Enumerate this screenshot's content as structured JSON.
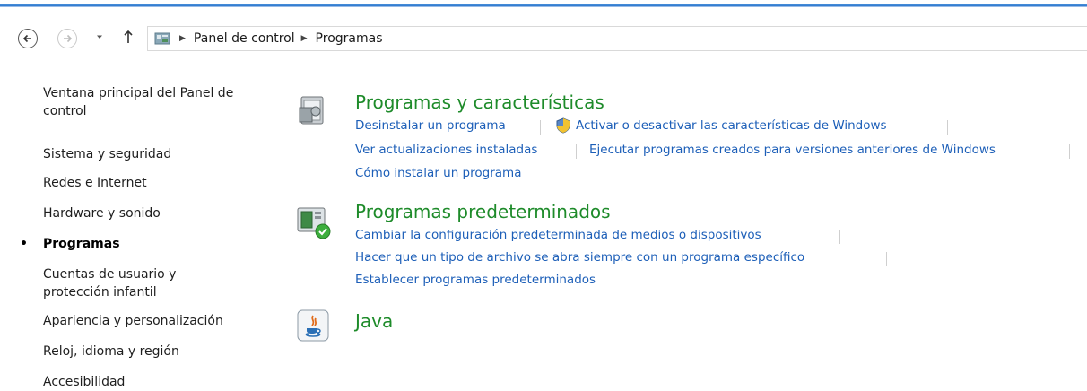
{
  "navigation": {
    "back_icon": "back-arrow-icon",
    "forward_icon": "forward-arrow-icon",
    "recent_icon": "chevron-down-icon",
    "up_icon": "up-arrow-icon",
    "breadcrumb": [
      "Panel de control",
      "Programas"
    ]
  },
  "sidebar": {
    "items": [
      {
        "label_line1": "Ventana principal del Panel de",
        "label_line2": "control"
      },
      {
        "label": "Sistema y seguridad"
      },
      {
        "label": "Redes e Internet"
      },
      {
        "label": "Hardware y sonido"
      },
      {
        "label": "Programas",
        "active": true
      },
      {
        "label_line1": "Cuentas de usuario y",
        "label_line2": "protección infantil"
      },
      {
        "label": "Apariencia y personalización"
      },
      {
        "label": "Reloj, idioma y región"
      },
      {
        "label": "Accesibilidad"
      }
    ]
  },
  "sections": [
    {
      "title": "Programas y características",
      "icon": "programs-features-icon",
      "links": [
        "Desinstalar un programa",
        "Activar o desactivar las características de Windows",
        "Ver actualizaciones instaladas",
        "Ejecutar programas creados para versiones anteriores de Windows",
        "Cómo instalar un programa"
      ]
    },
    {
      "title": "Programas predeterminados",
      "icon": "default-programs-icon",
      "links": [
        "Cambiar la configuración predeterminada de medios o dispositivos",
        "Hacer que un tipo de archivo se abra siempre con un programa específico",
        "Establecer programas predeterminados"
      ]
    },
    {
      "title": "Java",
      "icon": "java-icon",
      "links": []
    }
  ],
  "colors": {
    "accent_bar": "#2f78cf",
    "section_title": "#1e8b2a",
    "link": "#1d5fb8"
  }
}
